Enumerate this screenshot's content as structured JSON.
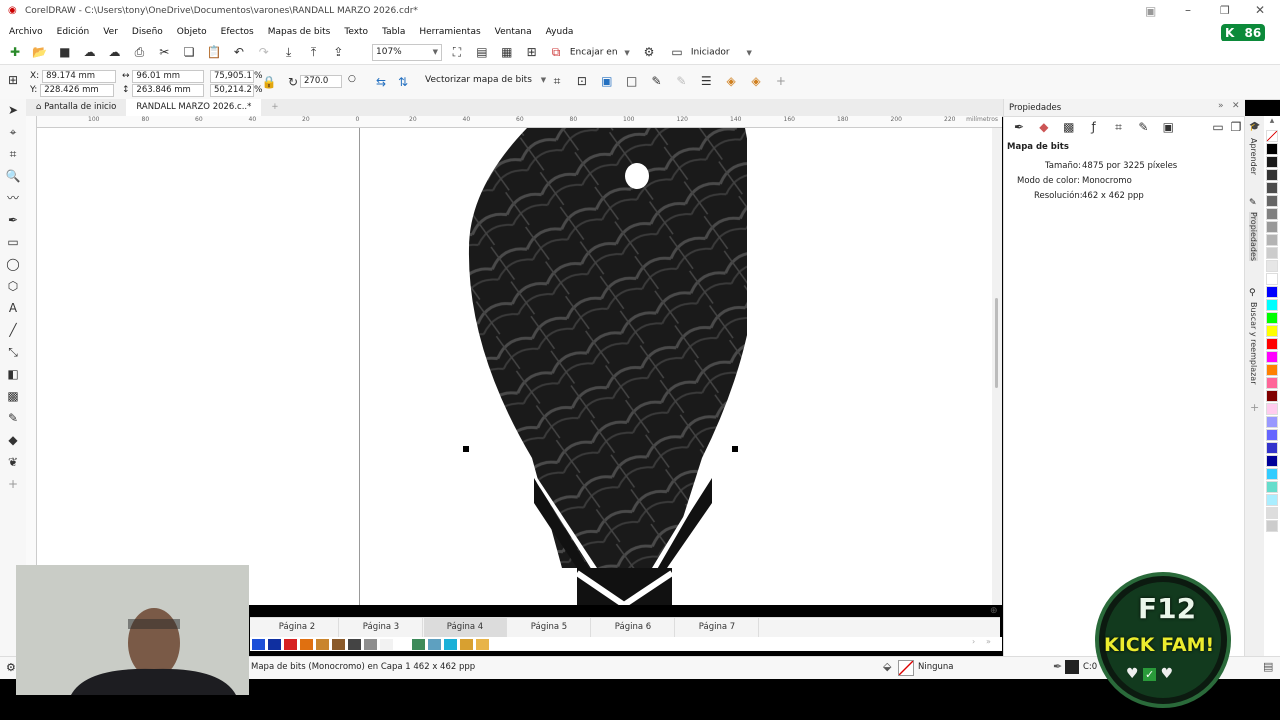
{
  "window": {
    "title": "CorelDRAW - C:\\Users\\tony\\OneDrive\\Documentos\\varones\\RANDALL MARZO 2026.cdr*",
    "badge_count": "86"
  },
  "menu": [
    "Archivo",
    "Edición",
    "Ver",
    "Diseño",
    "Objeto",
    "Efectos",
    "Mapas de bits",
    "Texto",
    "Tabla",
    "Herramientas",
    "Ventana",
    "Ayuda"
  ],
  "toolbar": {
    "zoom_value": "107%",
    "snap_label": "Encajar en",
    "workspace_label": "Iniciador"
  },
  "property_bar": {
    "x_label": "X:",
    "x_value": "89.174 mm",
    "y_label": "Y:",
    "y_value": "228.426 mm",
    "width_value": "96.01 mm",
    "height_value": "263.846 mm",
    "scale_x": "75,905.1",
    "scale_y": "50,214.2",
    "percent": "%",
    "rotation_value": "270.0",
    "trace_label": "Vectorizar mapa de bits"
  },
  "doc_tabs": [
    {
      "label": "Pantalla de inicio"
    },
    {
      "label": "RANDALL MARZO 2026.c..*"
    }
  ],
  "ruler": {
    "unit": "milímetros",
    "h_ticks": [
      "100",
      "80",
      "60",
      "40",
      "20",
      "0",
      "20",
      "40",
      "60",
      "80",
      "100",
      "120",
      "140",
      "160",
      "180",
      "200",
      "220"
    ]
  },
  "page_tabs": [
    "Página 2",
    "Página 3",
    "Página 4",
    "Página 5",
    "Página 6",
    "Página 7"
  ],
  "active_page": "Página 4",
  "bottom_palette": [
    "#1c4fd8",
    "#0f2fa0",
    "#d62020",
    "#e07010",
    "#c9852e",
    "#8a5a2a",
    "#444444",
    "#8f8f8f",
    "#f2f2f2",
    "#ffffff",
    "#3d8a5a",
    "#5ea0c0",
    "#1ab0d8",
    "#d8a030",
    "#e8b448"
  ],
  "status": {
    "object_info": "Mapa de bits (Monocromo) en Capa 1  462 x 462 ppp",
    "fill_label": "Ninguna",
    "outline_label": "C:0"
  },
  "properties_panel": {
    "title": "Propiedades",
    "section": "Mapa de bits",
    "size_label": "Tamaño:",
    "size_value": "4875 por 3225 píxeles",
    "mode_label": "Modo de color:",
    "mode_value": "Monocromo",
    "res_label": "Resolución:",
    "res_value": "462 x 462 ppp"
  },
  "side_tabs": [
    "Aprender",
    "Propiedades",
    "Buscar y reemplazar"
  ],
  "right_palette": [
    "#000000",
    "#1a1a1a",
    "#333333",
    "#4d4d4d",
    "#666666",
    "#808080",
    "#999999",
    "#b3b3b3",
    "#cccccc",
    "#e6e6e6",
    "#ffffff",
    "#0000ff",
    "#00ffff",
    "#00ff00",
    "#ffff00",
    "#ff0000",
    "#ff00ff",
    "#ff8000",
    "#ff6699",
    "#800000",
    "#ffccee",
    "#9999ff",
    "#6666ff",
    "#3333cc",
    "#000099",
    "#33ccff",
    "#66ddcc",
    "#aaeeff",
    "#dddddd",
    "#cccccc"
  ],
  "logo": {
    "line1": "F12",
    "line2": "KICK FAM!"
  }
}
